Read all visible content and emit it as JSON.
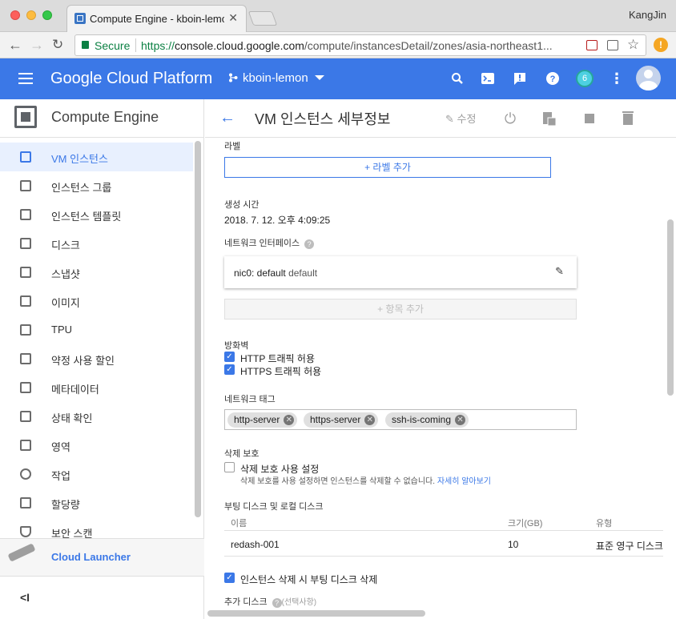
{
  "browser": {
    "tab_title": "Compute Engine - kboin-lemon",
    "user_name": "KangJin",
    "secure_label": "Secure",
    "url_scheme": "https://",
    "url_host": "console.cloud.google.com",
    "url_path": "/compute/instancesDetail/zones/asia-northeast1..."
  },
  "appbar": {
    "brand": "Google Cloud Platform",
    "project": "kboin-lemon",
    "notification_count": "6"
  },
  "sidebar": {
    "title": "Compute Engine",
    "items": [
      {
        "label": "VM 인스턴스",
        "active": true
      },
      {
        "label": "인스턴스 그룹"
      },
      {
        "label": "인스턴스 템플릿"
      },
      {
        "label": "디스크"
      },
      {
        "label": "스냅샷"
      },
      {
        "label": "이미지"
      },
      {
        "label": "TPU"
      },
      {
        "label": "약정 사용 할인"
      },
      {
        "label": "메타데이터"
      },
      {
        "label": "상태 확인"
      },
      {
        "label": "영역"
      },
      {
        "label": "작업"
      },
      {
        "label": "할당량"
      },
      {
        "label": "보안 스캔"
      }
    ],
    "launcher_label": "Cloud Launcher",
    "collapse_icon": "<I"
  },
  "header": {
    "title": "VM 인스턴스 세부정보",
    "edit_label": "수정"
  },
  "form": {
    "labels_title": "라벨",
    "add_label_button": "+ 라벨 추가",
    "created_title": "생성 시간",
    "created_value": "2018. 7. 12. 오후 4:09:25",
    "network_interfaces_title": "네트워크 인터페이스",
    "nic_name": "nic0: default",
    "nic_network": "default",
    "add_item_button": "+ 항목 추가",
    "firewall_title": "방화벽",
    "allow_http": "HTTP 트래픽 허용",
    "allow_https": "HTTPS 트래픽 허용",
    "network_tags_title": "네트워크 태그",
    "tags": [
      "http-server",
      "https-server",
      "ssh-is-coming"
    ],
    "deletion_protection_title": "삭제 보호",
    "deletion_protection_checkbox": "삭제 보호 사용 설정",
    "deletion_protection_hint": "삭제 보호를 사용 설정하면 인스턴스를 삭제할 수 없습니다.",
    "learn_more": "자세히 알아보기",
    "boot_disk_title": "부팅 디스크 및 로컬 디스크",
    "disk_columns": [
      "이름",
      "크기(GB)",
      "유형"
    ],
    "disk_row": {
      "name": "redash-001",
      "size": "10",
      "type": "표준 영구 디스크"
    },
    "delete_boot_disk": "인스턴스 삭제 시 부팅 디스크 삭제",
    "additional_disks_title": "추가 디스크",
    "optional_label": "(선택사항)"
  },
  "colors": {
    "accent": "#3b78e7",
    "secure": "#0b8043"
  }
}
